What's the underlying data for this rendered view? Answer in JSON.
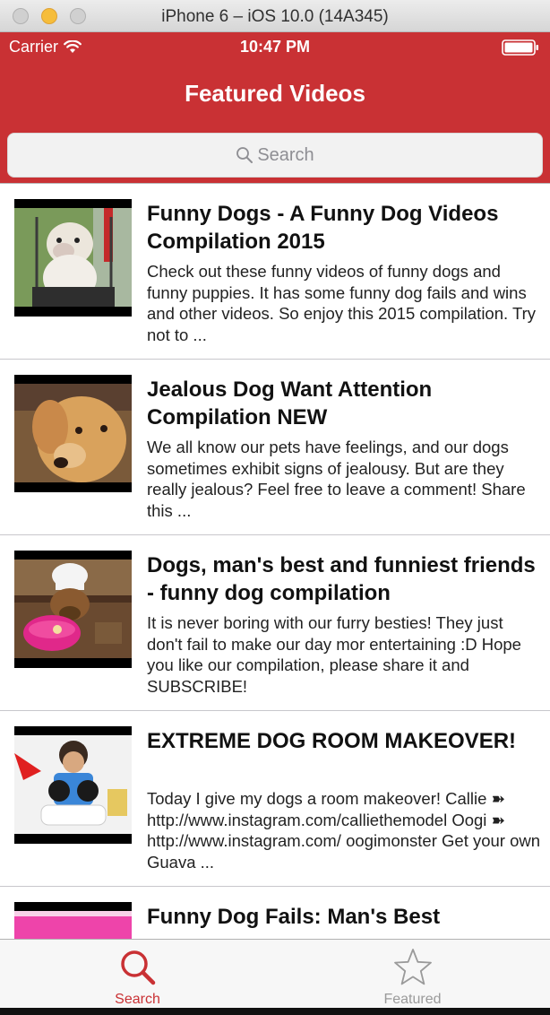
{
  "simulator": {
    "title": "iPhone 6 – iOS 10.0 (14A345)"
  },
  "status_bar": {
    "carrier": "Carrier",
    "time": "10:47 PM",
    "wifi_icon": "wifi-icon",
    "battery_icon": "battery-icon"
  },
  "nav": {
    "title": "Featured Videos"
  },
  "search": {
    "placeholder": "Search",
    "icon": "search-icon"
  },
  "colors": {
    "accent": "#c93134",
    "tab_inactive": "#9a9a9a"
  },
  "videos": [
    {
      "title": "Funny Dogs - A Funny Dog Videos Compilation 2015",
      "description": "Check out these funny videos of funny dogs and funny puppies. It has some funny dog fails and wins and other videos. So enjoy this 2015 compilation. Try not to ..."
    },
    {
      "title": "Jealous Dog Want Attention Compilation NEW",
      "description": "We all know our pets have feelings, and our dogs sometimes exhibit signs of jealousy. But are they really jealous? Feel free to leave a comment! Share this ..."
    },
    {
      "title": "Dogs, man's best and funniest friends - funny dog compilation",
      "description": "It is never boring with our furry besties! They just don't fail to make our day mor entertaining :D Hope you like our compilation, please share it and SUBSCRIBE!"
    },
    {
      "title": "EXTREME DOG ROOM MAKEOVER!",
      "description": "Today I give my dogs a room makeover! Callie ➽ http://www.instagram.com/calliethemodel Oogi ➽ http://www.instagram.com/ oogimonster Get your own Guava ..."
    },
    {
      "title": "Funny Dog Fails: Man's Best",
      "description": ""
    }
  ],
  "tabs": [
    {
      "label": "Search",
      "icon": "search-icon",
      "selected": true
    },
    {
      "label": "Featured",
      "icon": "star-icon",
      "selected": false
    }
  ]
}
